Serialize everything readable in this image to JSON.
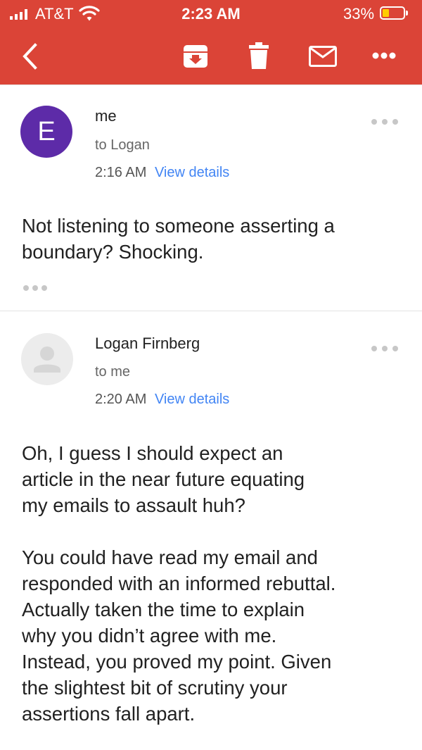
{
  "status_bar": {
    "carrier": "AT&T",
    "time": "2:23 AM",
    "battery_percent": "33%",
    "battery_level": 0.33,
    "battery_color": "#fecc00"
  },
  "toolbar": {
    "background": "#db4437",
    "icons": [
      "back-arrow-icon",
      "archive-icon",
      "trash-icon",
      "mail-icon",
      "more-horizontal-icon"
    ]
  },
  "messages": [
    {
      "avatar_letter": "E",
      "avatar_color": "#5d2ba8",
      "sender": "me",
      "recipient": "to Logan",
      "time": "2:16 AM",
      "details_link": "View details",
      "body": "Not listening to someone asserting a\nboundary? Shocking."
    },
    {
      "avatar_icon": "person-icon",
      "sender": "Logan Firnberg",
      "recipient": "to me",
      "time": "2:20 AM",
      "details_link": "View details",
      "body": "Oh, I guess I should expect an\narticle in the near future equating\nmy emails to assault huh?\n\nYou could have read my email and\nresponded with an informed rebuttal.\nActually taken the time to explain\nwhy you didn’t agree with me.\nInstead, you proved my point. Given\nthe slightest bit of scrutiny your\nassertions fall apart."
    }
  ]
}
